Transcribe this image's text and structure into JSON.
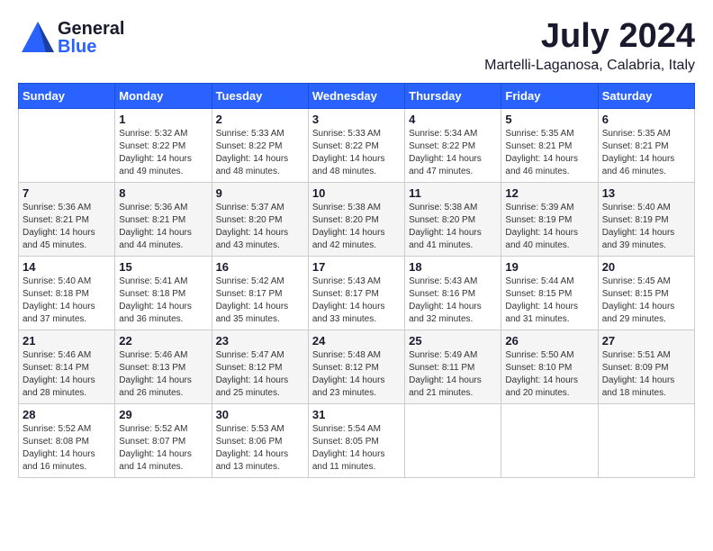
{
  "header": {
    "logo_general": "General",
    "logo_blue": "Blue",
    "month_year": "July 2024",
    "location": "Martelli-Laganosa, Calabria, Italy"
  },
  "days_of_week": [
    "Sunday",
    "Monday",
    "Tuesday",
    "Wednesday",
    "Thursday",
    "Friday",
    "Saturday"
  ],
  "weeks": [
    [
      {
        "day": "",
        "info": ""
      },
      {
        "day": "1",
        "info": "Sunrise: 5:32 AM\nSunset: 8:22 PM\nDaylight: 14 hours\nand 49 minutes."
      },
      {
        "day": "2",
        "info": "Sunrise: 5:33 AM\nSunset: 8:22 PM\nDaylight: 14 hours\nand 48 minutes."
      },
      {
        "day": "3",
        "info": "Sunrise: 5:33 AM\nSunset: 8:22 PM\nDaylight: 14 hours\nand 48 minutes."
      },
      {
        "day": "4",
        "info": "Sunrise: 5:34 AM\nSunset: 8:22 PM\nDaylight: 14 hours\nand 47 minutes."
      },
      {
        "day": "5",
        "info": "Sunrise: 5:35 AM\nSunset: 8:21 PM\nDaylight: 14 hours\nand 46 minutes."
      },
      {
        "day": "6",
        "info": "Sunrise: 5:35 AM\nSunset: 8:21 PM\nDaylight: 14 hours\nand 46 minutes."
      }
    ],
    [
      {
        "day": "7",
        "info": "Sunrise: 5:36 AM\nSunset: 8:21 PM\nDaylight: 14 hours\nand 45 minutes."
      },
      {
        "day": "8",
        "info": "Sunrise: 5:36 AM\nSunset: 8:21 PM\nDaylight: 14 hours\nand 44 minutes."
      },
      {
        "day": "9",
        "info": "Sunrise: 5:37 AM\nSunset: 8:20 PM\nDaylight: 14 hours\nand 43 minutes."
      },
      {
        "day": "10",
        "info": "Sunrise: 5:38 AM\nSunset: 8:20 PM\nDaylight: 14 hours\nand 42 minutes."
      },
      {
        "day": "11",
        "info": "Sunrise: 5:38 AM\nSunset: 8:20 PM\nDaylight: 14 hours\nand 41 minutes."
      },
      {
        "day": "12",
        "info": "Sunrise: 5:39 AM\nSunset: 8:19 PM\nDaylight: 14 hours\nand 40 minutes."
      },
      {
        "day": "13",
        "info": "Sunrise: 5:40 AM\nSunset: 8:19 PM\nDaylight: 14 hours\nand 39 minutes."
      }
    ],
    [
      {
        "day": "14",
        "info": "Sunrise: 5:40 AM\nSunset: 8:18 PM\nDaylight: 14 hours\nand 37 minutes."
      },
      {
        "day": "15",
        "info": "Sunrise: 5:41 AM\nSunset: 8:18 PM\nDaylight: 14 hours\nand 36 minutes."
      },
      {
        "day": "16",
        "info": "Sunrise: 5:42 AM\nSunset: 8:17 PM\nDaylight: 14 hours\nand 35 minutes."
      },
      {
        "day": "17",
        "info": "Sunrise: 5:43 AM\nSunset: 8:17 PM\nDaylight: 14 hours\nand 33 minutes."
      },
      {
        "day": "18",
        "info": "Sunrise: 5:43 AM\nSunset: 8:16 PM\nDaylight: 14 hours\nand 32 minutes."
      },
      {
        "day": "19",
        "info": "Sunrise: 5:44 AM\nSunset: 8:15 PM\nDaylight: 14 hours\nand 31 minutes."
      },
      {
        "day": "20",
        "info": "Sunrise: 5:45 AM\nSunset: 8:15 PM\nDaylight: 14 hours\nand 29 minutes."
      }
    ],
    [
      {
        "day": "21",
        "info": "Sunrise: 5:46 AM\nSunset: 8:14 PM\nDaylight: 14 hours\nand 28 minutes."
      },
      {
        "day": "22",
        "info": "Sunrise: 5:46 AM\nSunset: 8:13 PM\nDaylight: 14 hours\nand 26 minutes."
      },
      {
        "day": "23",
        "info": "Sunrise: 5:47 AM\nSunset: 8:12 PM\nDaylight: 14 hours\nand 25 minutes."
      },
      {
        "day": "24",
        "info": "Sunrise: 5:48 AM\nSunset: 8:12 PM\nDaylight: 14 hours\nand 23 minutes."
      },
      {
        "day": "25",
        "info": "Sunrise: 5:49 AM\nSunset: 8:11 PM\nDaylight: 14 hours\nand 21 minutes."
      },
      {
        "day": "26",
        "info": "Sunrise: 5:50 AM\nSunset: 8:10 PM\nDaylight: 14 hours\nand 20 minutes."
      },
      {
        "day": "27",
        "info": "Sunrise: 5:51 AM\nSunset: 8:09 PM\nDaylight: 14 hours\nand 18 minutes."
      }
    ],
    [
      {
        "day": "28",
        "info": "Sunrise: 5:52 AM\nSunset: 8:08 PM\nDaylight: 14 hours\nand 16 minutes."
      },
      {
        "day": "29",
        "info": "Sunrise: 5:52 AM\nSunset: 8:07 PM\nDaylight: 14 hours\nand 14 minutes."
      },
      {
        "day": "30",
        "info": "Sunrise: 5:53 AM\nSunset: 8:06 PM\nDaylight: 14 hours\nand 13 minutes."
      },
      {
        "day": "31",
        "info": "Sunrise: 5:54 AM\nSunset: 8:05 PM\nDaylight: 14 hours\nand 11 minutes."
      },
      {
        "day": "",
        "info": ""
      },
      {
        "day": "",
        "info": ""
      },
      {
        "day": "",
        "info": ""
      }
    ]
  ]
}
